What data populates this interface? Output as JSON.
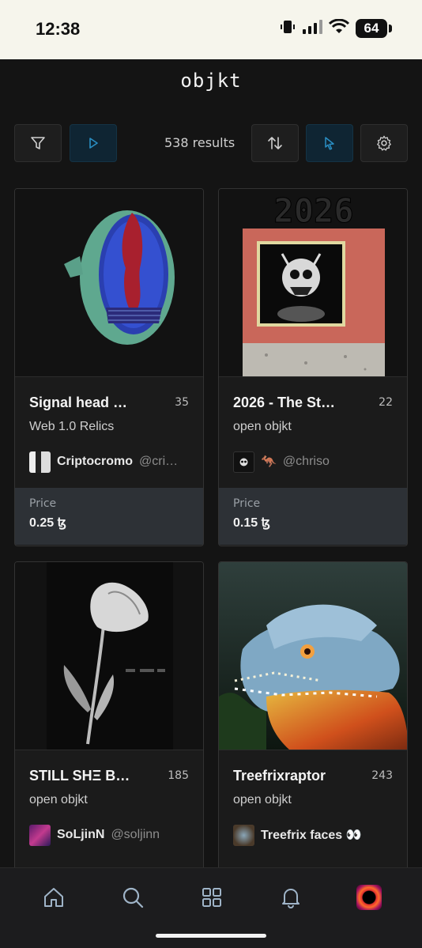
{
  "status": {
    "time": "12:38",
    "battery": "64"
  },
  "app": {
    "title": "objkt"
  },
  "toolbar": {
    "results": "538 results"
  },
  "cards": [
    {
      "title": "Signal head …",
      "edition": "35",
      "collection": "Web 1.0 Relics",
      "creator_name": "Criptocromo",
      "creator_handle": "@cri…",
      "price_label": "Price",
      "price": "0.25 ꜩ"
    },
    {
      "title": "2026 - The St…",
      "edition": "22",
      "collection": "open objkt",
      "creator_name": "",
      "creator_handle": "@chriso",
      "creator_emoji": "🦘",
      "price_label": "Price",
      "price": "0.15 ꜩ"
    },
    {
      "title": "STILL SHΞ B…",
      "edition": "185",
      "collection": "open objkt",
      "creator_name": "SoLjinN",
      "creator_handle": "@soljinn"
    },
    {
      "title": "Treefrixraptor",
      "edition": "243",
      "collection": "open objkt",
      "creator_name": "Treefrix faces 👀",
      "creator_handle": ""
    }
  ],
  "artwork_text": {
    "card2_banner": "2026"
  },
  "colors": {
    "accent": "#1f6f9a",
    "background": "#141414",
    "card": "#1b1b1b",
    "price_bg": "#2d3136"
  },
  "nav": [
    "home-icon",
    "search-icon",
    "grid-icon",
    "bell-icon",
    "profile-avatar"
  ]
}
